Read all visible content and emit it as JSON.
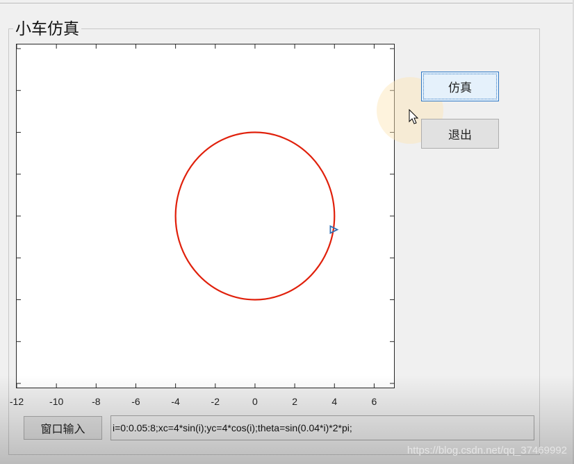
{
  "panel": {
    "title": "小车仿真"
  },
  "buttons": {
    "simulate": "仿真",
    "exit": "退出",
    "window_input": "窗口输入"
  },
  "command": {
    "value": "i=0:0.05:8;xc=4*sin(i);yc=4*cos(i);theta=sin(0.04*i)*2*pi;"
  },
  "watermark": "https://blog.csdn.net/qq_37469992",
  "chart_data": {
    "type": "line",
    "title": "",
    "xlabel": "",
    "ylabel": "",
    "xlim": [
      -12,
      7
    ],
    "ylim": [
      -8.2,
      8.2
    ],
    "x_ticks": [
      -12,
      -10,
      -8,
      -6,
      -4,
      -2,
      0,
      2,
      4,
      6
    ],
    "x_tick_labels": [
      "-12",
      "-10",
      "-8",
      "-6",
      "-4",
      "-2",
      "0",
      "2",
      "4",
      "6"
    ],
    "y_tick_labels_visible": false,
    "series": [
      {
        "kind": "circle",
        "center": [
          0,
          0
        ],
        "radius": 4,
        "color": "#e0200b"
      }
    ],
    "marker": {
      "shape": "triangle-right",
      "x": 3.9,
      "y": -0.65,
      "color": "#2f6fb5"
    },
    "grid": false
  }
}
